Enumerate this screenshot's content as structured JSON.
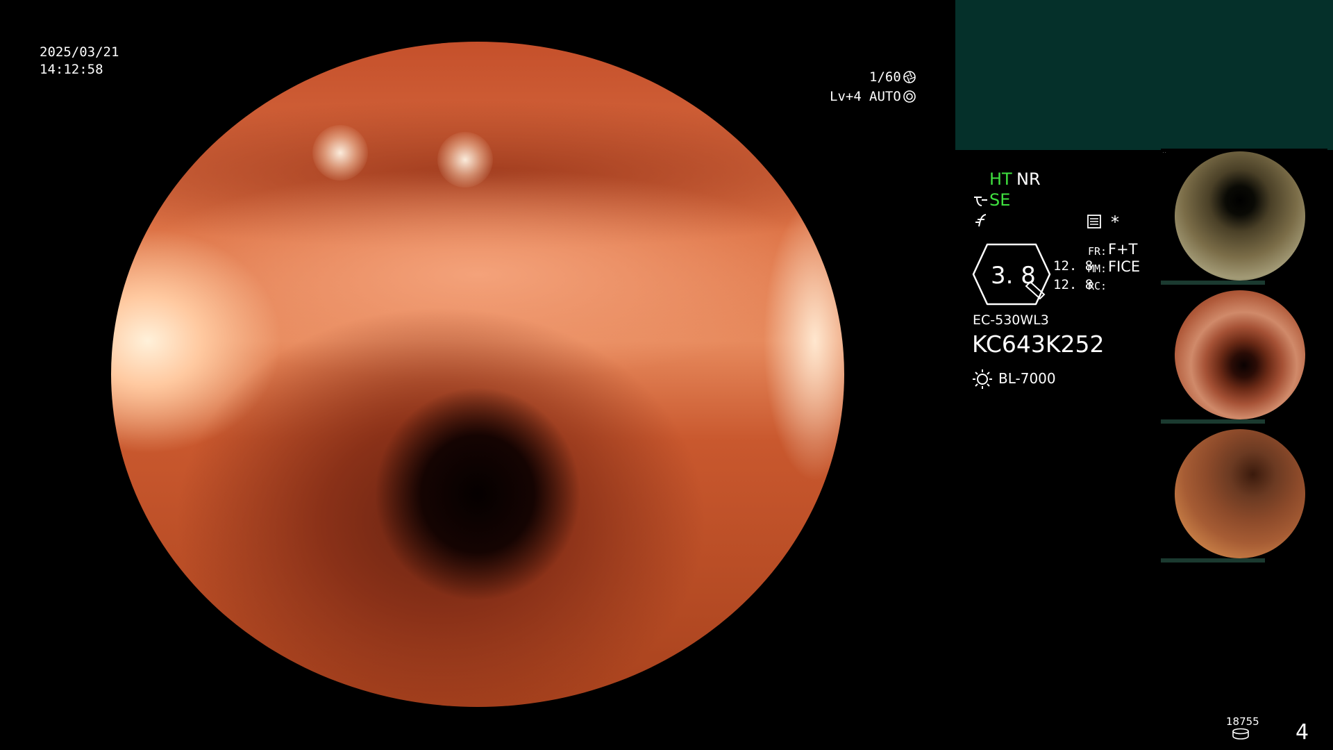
{
  "datetime": {
    "date": "2025/03/21",
    "time": "14:12:58"
  },
  "exposure": {
    "shutter": "1/60",
    "level": "Lv+4",
    "mode": "AUTO"
  },
  "modes": {
    "ht": "HT",
    "nr": "NR",
    "se": "SE",
    "star": "*"
  },
  "enhancement": {
    "value": "3. 8",
    "val1": "12. 8",
    "val2": "12. 8",
    "fr_label": "FR:",
    "fr_value": "F+T",
    "mm_label": "MM:",
    "mm_value": "FICE",
    "rc_label": "RC:"
  },
  "scope": {
    "model": "EC-530WL3",
    "serial": "KC643K252",
    "light_source": "BL-7000"
  },
  "storage": {
    "count": "18755"
  },
  "page_number": "4",
  "colors": {
    "mode_green": "#3fe03f",
    "panel_green": "#05302a"
  },
  "icons": [
    "shutter-icon",
    "auto-iris-icon",
    "scope-hook-icon",
    "curve-icon",
    "memo-icon",
    "hexagon-gauge-icon",
    "lamp-icon",
    "disk-stack-icon"
  ]
}
